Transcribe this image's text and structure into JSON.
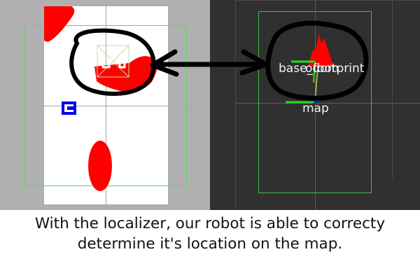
{
  "left_view": {
    "name": "map-view"
  },
  "right_view": {
    "frame_labels": {
      "base_footprint": "base_footprint",
      "odom": "odom",
      "map": "map"
    }
  },
  "caption": {
    "line1": "With the localizer, our robot is able to correcty",
    "line2": "determine it's location on the map."
  },
  "colors": {
    "obstacle": "#ff0000",
    "grid": "#5ad85a",
    "marker": "#0000ee",
    "annotation": "#000000",
    "axis_x": "#22dd22",
    "axis_y": "#2222ff"
  }
}
